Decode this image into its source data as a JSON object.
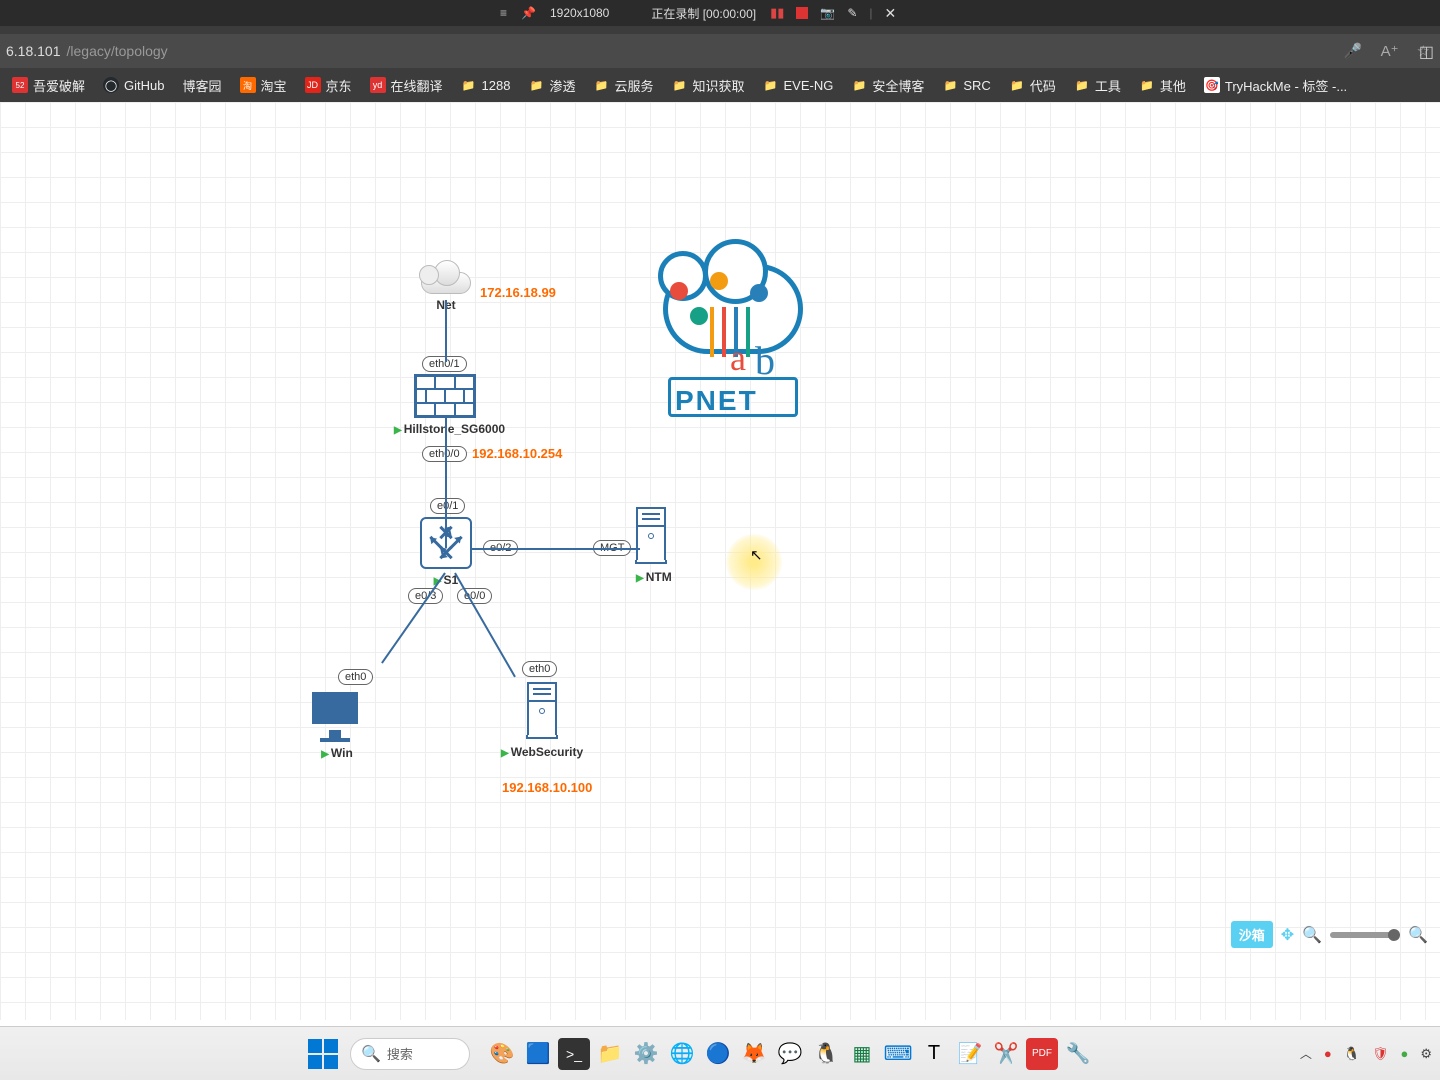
{
  "recorder": {
    "menu": "≡",
    "pin": "📌",
    "resolution": "1920x1080",
    "status": "正在录制 [00:00:00]"
  },
  "browser": {
    "url_host": "6.18.101",
    "url_path": "/legacy/topology"
  },
  "bookmarks": [
    {
      "label": "吾爱破解",
      "icon": "red"
    },
    {
      "label": "GitHub",
      "icon": "gh"
    },
    {
      "label": "博客园",
      "icon": "fold"
    },
    {
      "label": "淘宝",
      "icon": "tb"
    },
    {
      "label": "京东",
      "icon": "jd"
    },
    {
      "label": "在线翻译",
      "icon": "yd"
    },
    {
      "label": "1288",
      "icon": "fold"
    },
    {
      "label": "渗透",
      "icon": "fold"
    },
    {
      "label": "云服务",
      "icon": "fold"
    },
    {
      "label": "知识获取",
      "icon": "fold"
    },
    {
      "label": "EVE-NG",
      "icon": "fold"
    },
    {
      "label": "安全博客",
      "icon": "fold"
    },
    {
      "label": "SRC",
      "icon": "fold"
    },
    {
      "label": "代码",
      "icon": "fold"
    },
    {
      "label": "工具",
      "icon": "fold"
    },
    {
      "label": "其他",
      "icon": "fold"
    },
    {
      "label": "TryHackMe - 标签 -...",
      "icon": "thm"
    }
  ],
  "logo": {
    "text": "PNET"
  },
  "nodes": {
    "net": {
      "label": "Net",
      "ip": "172.16.18.99"
    },
    "firewall": {
      "label": "Hillstone_SG6000",
      "ip": "192.168.10.254",
      "if_top": "eth0/1",
      "if_bot": "eth0/0"
    },
    "switch": {
      "label": "S1",
      "if_top": "e0/1",
      "if_right": "e0/2",
      "if_bl": "e0/3",
      "if_br": "e0/0"
    },
    "ntm": {
      "label": "NTM",
      "if": "MGT"
    },
    "win": {
      "label": "Win",
      "if": "eth0"
    },
    "websec": {
      "label": "WebSecurity",
      "if": "eth0",
      "ip": "192.168.10.100"
    }
  },
  "controls": {
    "sandbox": "沙箱"
  },
  "taskbar": {
    "search": "搜索"
  }
}
